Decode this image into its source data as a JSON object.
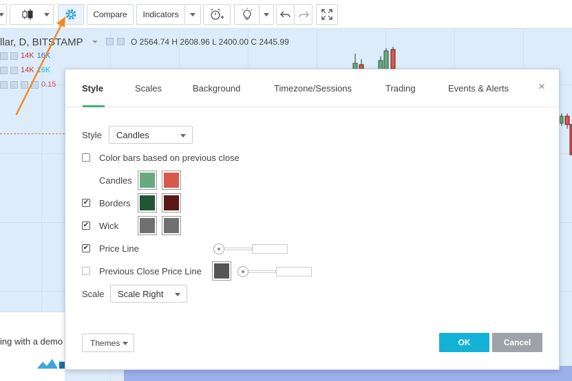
{
  "toolbar": {
    "compare_label": "Compare",
    "indicators_label": "Indicators"
  },
  "chart": {
    "legend_title": "llar, D, BITSTAMP",
    "ohlc": "O 2564.74 H 2608.96 L 2400.00 C 2445.99",
    "ind1": {
      "a": "14K",
      "b": "16K"
    },
    "ind2": {
      "a": "14K",
      "b": "16K"
    },
    "ind3_value": "0.15",
    "banner_text": "ing with a demo"
  },
  "dialog": {
    "tabs": [
      {
        "label": "Style"
      },
      {
        "label": "Scales"
      },
      {
        "label": "Background"
      },
      {
        "label": "Timezone/Sessions"
      },
      {
        "label": "Trading"
      },
      {
        "label": "Events & Alerts"
      }
    ],
    "close_symbol": "×",
    "style_label": "Style",
    "style_value": "Candles",
    "color_bars_label": "Color bars based on previous close",
    "candles_label": "Candles",
    "borders_label": "Borders",
    "wick_label": "Wick",
    "price_line_label": "Price Line",
    "prev_close_label": "Previous Close Price Line",
    "scale_label": "Scale",
    "scale_value": "Scale Right",
    "themes_label": "Themes",
    "ok_label": "OK",
    "cancel_label": "Cancel",
    "check_mark": "✔"
  },
  "colors": {
    "candle_up": "#6aa882",
    "candle_down": "#d9584a",
    "border_up": "#225535",
    "border_down": "#5a1818",
    "wick_up": "#707070",
    "wick_down": "#707070",
    "prev_close": "#555555",
    "accent": "#13b1d6",
    "arrow": "#f08a24"
  }
}
